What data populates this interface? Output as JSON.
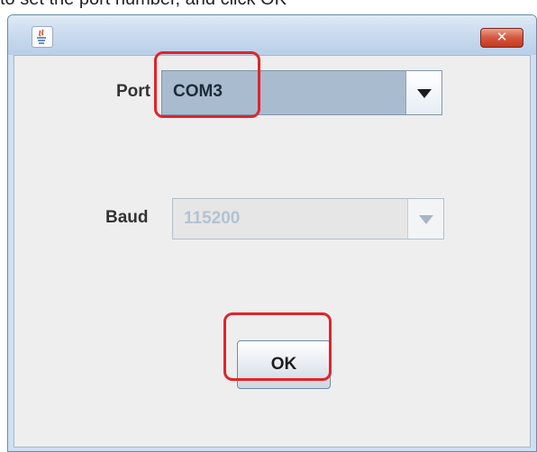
{
  "top_caption": "to set the port number, and click OK",
  "window": {
    "close_label": "✕"
  },
  "port": {
    "label": "Port",
    "value": "COM3"
  },
  "baud": {
    "label": "Baud",
    "value": "115200"
  },
  "ok_button": {
    "label": "OK"
  },
  "colors": {
    "highlight": "#e1242a"
  }
}
